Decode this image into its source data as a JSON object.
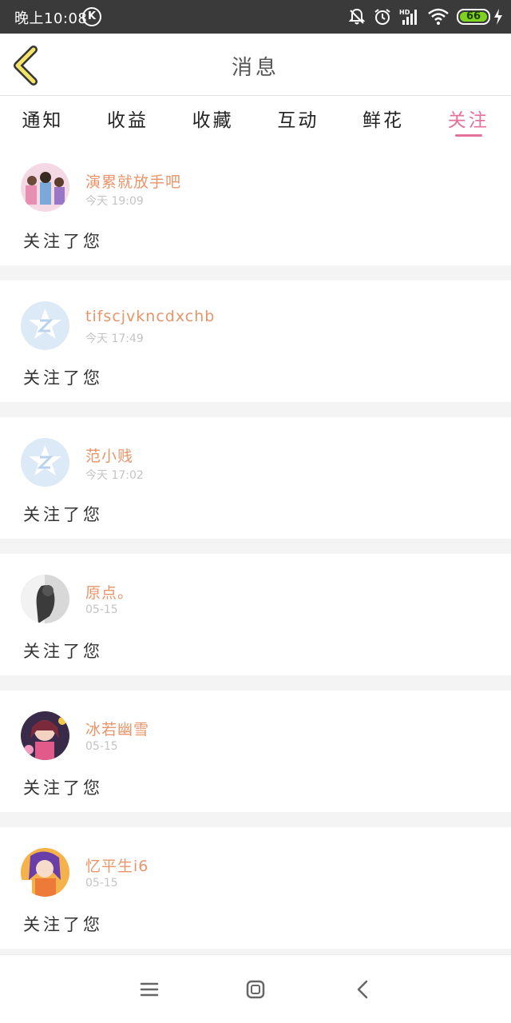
{
  "status_bar": {
    "time": "晚上10:08",
    "k_label": "K",
    "battery": "66"
  },
  "header": {
    "title": "消息"
  },
  "tabs": [
    {
      "label": "通知"
    },
    {
      "label": "收益"
    },
    {
      "label": "收藏"
    },
    {
      "label": "互动"
    },
    {
      "label": "鲜花"
    },
    {
      "label": "关注"
    }
  ],
  "active_tab": "关注",
  "accent_color": "#e4719c",
  "username_color": "#e8956a",
  "items": [
    {
      "name": "演累就放手吧",
      "time": "今天 19:09",
      "message": "关注了您",
      "avatar": "photo-avatar"
    },
    {
      "name": "tifscjvkncdxchb",
      "time": "今天 17:49",
      "message": "关注了您",
      "avatar": "default-qzone-avatar"
    },
    {
      "name": "范小贱",
      "time": "今天 17:02",
      "message": "关注了您",
      "avatar": "default-qzone-avatar"
    },
    {
      "name": "原点。",
      "time": "05-15",
      "message": "关注了您",
      "avatar": "photo-avatar"
    },
    {
      "name": "冰若幽雪",
      "time": "05-15",
      "message": "关注了您",
      "avatar": "anime-avatar"
    },
    {
      "name": "忆平生i6",
      "time": "05-15",
      "message": "关注了您",
      "avatar": "anime-avatar"
    }
  ],
  "nav": {
    "menu": "menu-icon",
    "home": "home-icon",
    "back": "back-icon"
  }
}
